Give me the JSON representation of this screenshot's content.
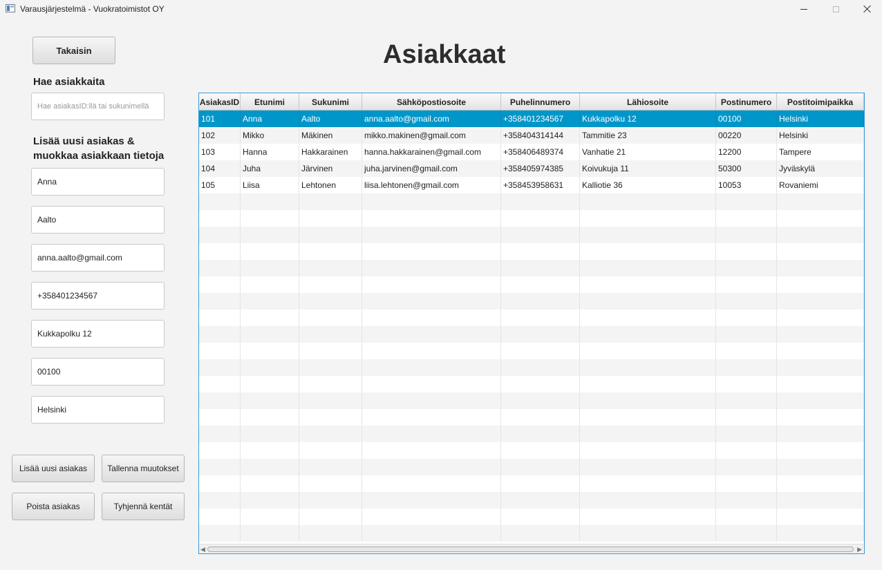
{
  "window": {
    "title": "Varausjärjestelmä - Vuokratoimistot OY",
    "icon": "app-window-icon",
    "controls": [
      "minimize-icon",
      "maximize-icon",
      "close-icon"
    ]
  },
  "page": {
    "title": "Asiakkaat",
    "back_label": "Takaisin"
  },
  "search": {
    "heading": "Hae asiakkaita",
    "placeholder": "Hae asiakasID:llä tai sukunimellä"
  },
  "form": {
    "heading": "Lisää uusi asiakas & muokkaa asiakkaan tietoja",
    "fields": {
      "etunimi": "Anna",
      "sukunimi": "Aalto",
      "email": "anna.aalto@gmail.com",
      "puhelin": "+358401234567",
      "lahiosoite": "Kukkapolku 12",
      "postinumero": "00100",
      "postitoimipaikka": "Helsinki"
    }
  },
  "actions": {
    "add_label": "Lisää uusi asiakas",
    "save_label": "Tallenna muutokset",
    "delete_label": "Poista asiakas",
    "clear_label": "Tyhjennä kentät"
  },
  "table": {
    "columns": [
      "AsiakasID",
      "Etunimi",
      "Sukunimi",
      "Sähköpostiosoite",
      "Puhelinnumero",
      "Lähiosoite",
      "Postinumero",
      "Postitoimipaikka"
    ],
    "rows": [
      [
        "101",
        "Anna",
        "Aalto",
        "anna.aalto@gmail.com",
        "+358401234567",
        "Kukkapolku 12",
        "00100",
        "Helsinki"
      ],
      [
        "102",
        "Mikko",
        "Mäkinen",
        "mikko.makinen@gmail.com",
        "+358404314144",
        "Tammitie 23",
        "00220",
        "Helsinki"
      ],
      [
        "103",
        "Hanna",
        "Hakkarainen",
        "hanna.hakkarainen@gmail.com",
        "+358406489374",
        "Vanhatie 21",
        "12200",
        "Tampere"
      ],
      [
        "104",
        "Juha",
        "Järvinen",
        "juha.jarvinen@gmail.com",
        "+358405974385",
        "Koivukuja 11",
        "50300",
        "Jyväskylä"
      ],
      [
        "105",
        "Liisa",
        "Lehtonen",
        "liisa.lehtonen@gmail.com",
        "+358453958631",
        "Kalliotie 36",
        "10053",
        "Rovaniemi"
      ]
    ],
    "selected_row": 0
  },
  "colors": {
    "selection": "#0096c9",
    "focus_border": "#3a9ad9"
  }
}
